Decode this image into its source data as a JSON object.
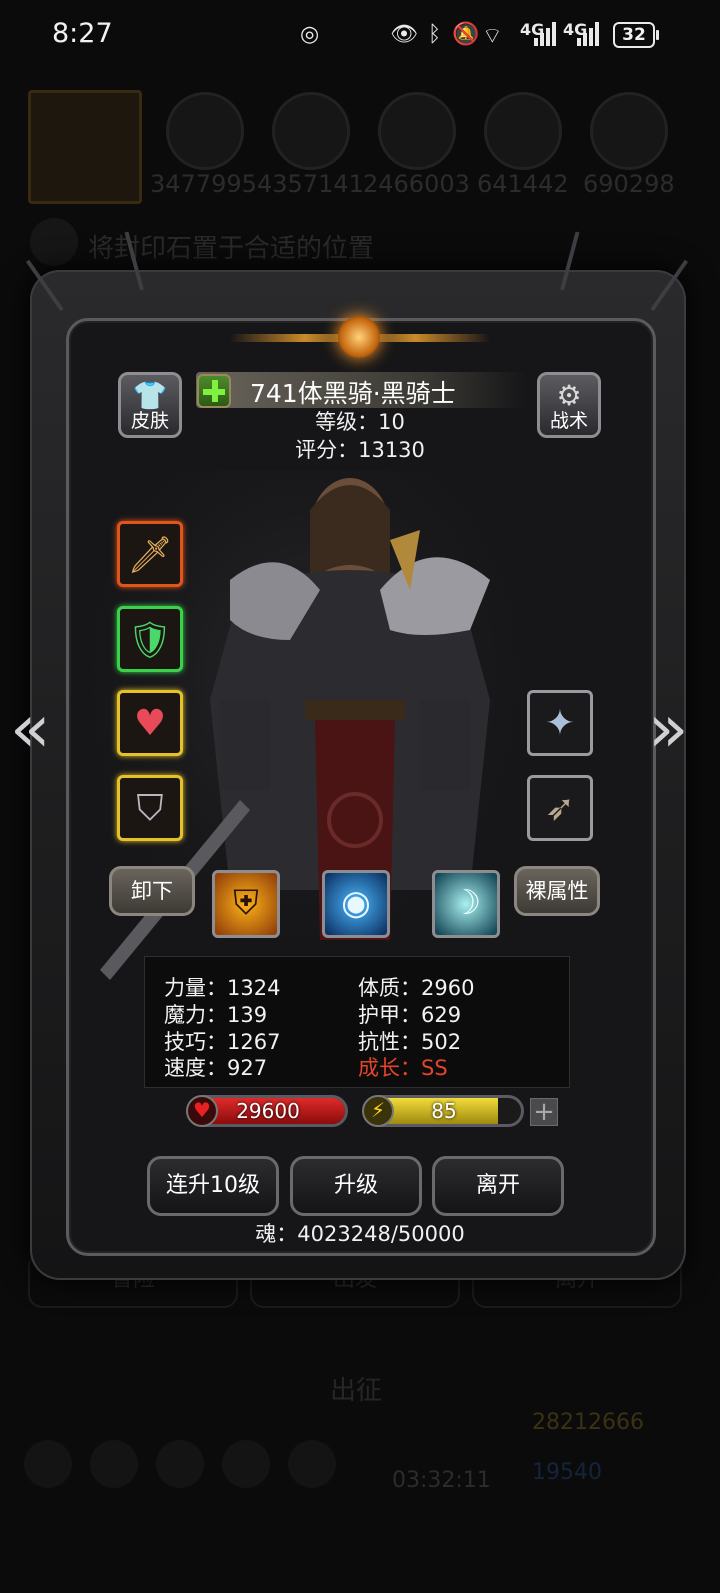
{
  "status_bar": {
    "time": "8:27",
    "network_1": "4G",
    "network_2": "4G",
    "battery": "32"
  },
  "background": {
    "resources": [
      "3477995",
      "4357141",
      "2466003",
      "641442",
      "690298"
    ],
    "hint": "将封印石置于合适的位置",
    "tabs": [
      "冒险",
      "出发",
      "离开"
    ],
    "expedition": "出征",
    "gold": "28212666",
    "gems": "19540",
    "timer": "03:32:11"
  },
  "panel": {
    "skin_label": "皮肤",
    "tactics_label": "战术",
    "hero_name": "741体黑骑·黑骑士",
    "level": "等级：10",
    "score": "评分：13130",
    "unequip_label": "卸下",
    "bare_stats_label": "裸属性",
    "stats": {
      "strength": "力量：1324",
      "constitution": "体质：2960",
      "magic": "魔力：139",
      "armor": "护甲：629",
      "skill": "技巧：1267",
      "resistance": "抗性：502",
      "speed": "速度：927",
      "growth": "成长：SS"
    },
    "hp": "29600",
    "energy": "85",
    "energy_fraction": 0.85,
    "buttons": {
      "level10": "连升10级",
      "levelup": "升级",
      "leave": "离开"
    },
    "soul": "魂：4023248/50000"
  },
  "colors": {
    "hp_bar": "#c01818",
    "energy_bar": "#d8c028",
    "growth_text": "#e4442a"
  }
}
